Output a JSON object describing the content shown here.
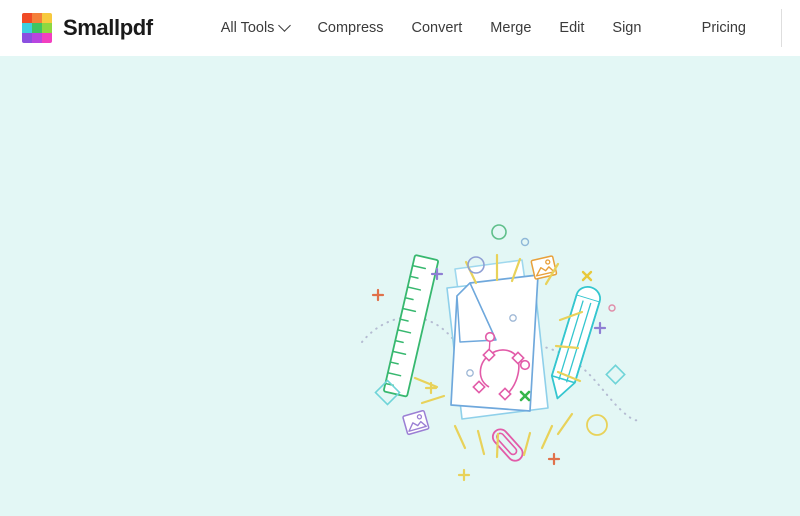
{
  "header": {
    "brand": {
      "name": "Smallpdf",
      "logo_icon": "smallpdf-color-grid-logo",
      "logo_colors": [
        "#f04b26",
        "#f4803a",
        "#f7c93e",
        "#3ecfe0",
        "#3fc462",
        "#8ed840",
        "#8b4fe0",
        "#b845e0",
        "#f23fbf"
      ]
    },
    "nav": [
      {
        "label": "All Tools",
        "has_dropdown": true,
        "icon": "chevron-down-icon"
      },
      {
        "label": "Compress",
        "has_dropdown": false
      },
      {
        "label": "Convert",
        "has_dropdown": false
      },
      {
        "label": "Merge",
        "has_dropdown": false
      },
      {
        "label": "Edit",
        "has_dropdown": false
      },
      {
        "label": "Sign",
        "has_dropdown": false
      }
    ],
    "pricing": {
      "label": "Pricing"
    }
  },
  "hero": {
    "background_color": "#e3f7f5",
    "illustration": {
      "name": "document-editing-illustration",
      "elements": [
        "stacked-paper-documents",
        "bezier-pen-path",
        "green-ruler",
        "cyan-pencil",
        "pink-paperclip",
        "photo-icons",
        "sparkle-dashes",
        "dotted-curves",
        "plus-marks",
        "circles",
        "diamonds",
        "x-marks"
      ]
    },
    "colors": {
      "paper_stroke": "#6fa8dc",
      "paper_stroke_back": "#9fd8ee",
      "pen_path": "#e25ba8",
      "ruler": "#37b86f",
      "pencil": "#34c6cf",
      "paperclip": "#e25ba8",
      "dash_yellow": "#e8d25a",
      "purple": "#9b7fd4",
      "orange": "#e8873a",
      "green_x": "#35b54a",
      "dotted": "#b9bfd4"
    }
  }
}
